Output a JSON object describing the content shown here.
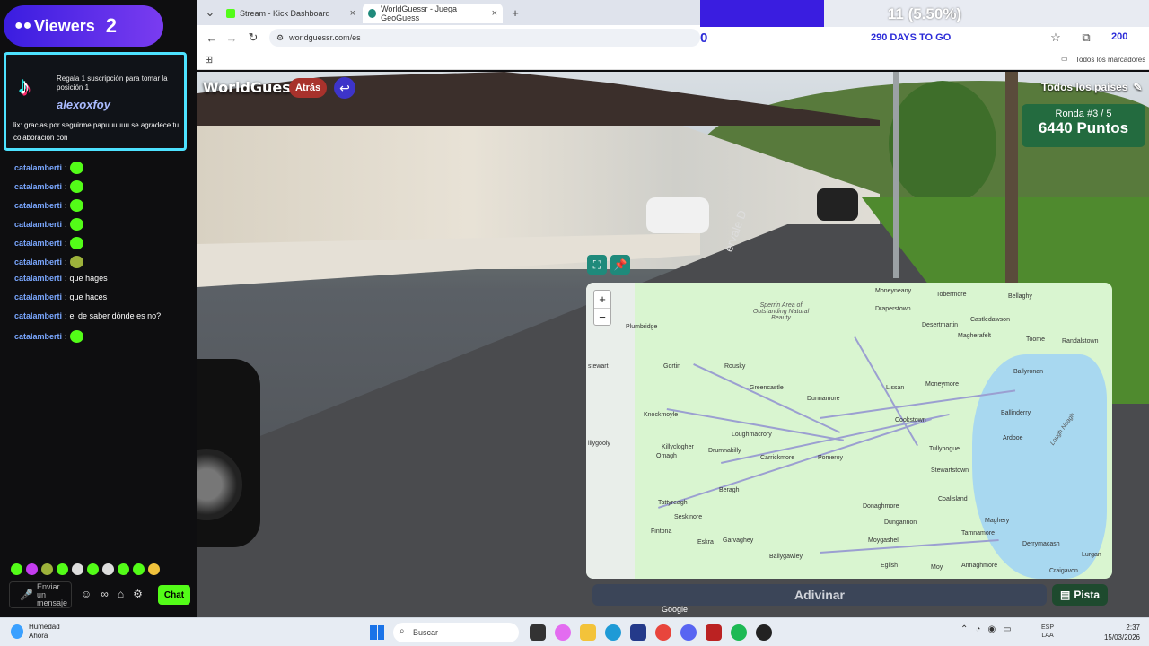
{
  "browser": {
    "tabs": [
      {
        "label": "Stream - Kick Dashboard",
        "icon": "kick-icon",
        "color": "#53fc18"
      },
      {
        "label": "WorldGuessr - Juega GeoGuess",
        "icon": "globe-icon",
        "color": "#1f8a7b"
      }
    ],
    "url": "worldguessr.com/es",
    "bookmarks_label": "Todos los marcadores",
    "profile_short": "200"
  },
  "overlay_progress": {
    "label": "11 (5.50%)",
    "fraction": 0.055,
    "start_value": "0",
    "days_left": "290 DAYS TO GO",
    "color": "#3a1de0"
  },
  "game": {
    "logo": "WorldGuessr",
    "back_label": "Atrás",
    "countries_label": "Todos los países",
    "round_label": "Ronda #3 / 5",
    "points_label": "6440 Puntos",
    "guess_label": "Adivinar",
    "hint_label": "Pista",
    "google_label": "Google",
    "zoom_in": "+",
    "zoom_out": "−",
    "street_sign": "ervale D",
    "places": [
      {
        "name": "Sperrin Area of Outstanding Natural Beauty",
        "italic": true
      },
      {
        "name": "Moneyneany"
      },
      {
        "name": "Tobermore"
      },
      {
        "name": "Bellaghy"
      },
      {
        "name": "Draperstown"
      },
      {
        "name": "Castledawson"
      },
      {
        "name": "Plumbridge"
      },
      {
        "name": "Desertmartin"
      },
      {
        "name": "Magherafelt"
      },
      {
        "name": "Toome"
      },
      {
        "name": "Randalstown"
      },
      {
        "name": "Gortin"
      },
      {
        "name": "Rousky"
      },
      {
        "name": "Ballyronan"
      },
      {
        "name": "Greencastle"
      },
      {
        "name": "Lissan"
      },
      {
        "name": "Moneymore"
      },
      {
        "name": "Dunnamore"
      },
      {
        "name": "Knockmoyle"
      },
      {
        "name": "Cookstown"
      },
      {
        "name": "Ballinderry"
      },
      {
        "name": "Loughmacrory"
      },
      {
        "name": "Tullyhogue"
      },
      {
        "name": "Ardboe"
      },
      {
        "name": "Killyclogher"
      },
      {
        "name": "Omagh"
      },
      {
        "name": "Drumnakilly"
      },
      {
        "name": "Carrickmore"
      },
      {
        "name": "Pomeroy"
      },
      {
        "name": "Stewartstown"
      },
      {
        "name": "Beragh"
      },
      {
        "name": "Coalisland"
      },
      {
        "name": "Tattyreagh"
      },
      {
        "name": "Seskinore"
      },
      {
        "name": "Donaghmore"
      },
      {
        "name": "Dungannon"
      },
      {
        "name": "Maghery"
      },
      {
        "name": "Fintona"
      },
      {
        "name": "Eskra"
      },
      {
        "name": "Garvaghey"
      },
      {
        "name": "Tamnamore"
      },
      {
        "name": "Derrymacash"
      },
      {
        "name": "Ballygawley"
      },
      {
        "name": "Moygashel"
      },
      {
        "name": "Eglish"
      },
      {
        "name": "Moy"
      },
      {
        "name": "Annaghmore"
      },
      {
        "name": "Craigavon"
      },
      {
        "name": "Lurgan"
      },
      {
        "name": "Lough Neagh",
        "italic": true
      },
      {
        "name": "stewart"
      },
      {
        "name": "illygooly"
      }
    ]
  },
  "stream_panel": {
    "viewers_label": "Viewers",
    "viewers_count": "2",
    "tiktok_gift": "Regala 1 suscripción para tomar la posición 1",
    "tiktok_user": "alexoxfoy",
    "tiktok_message": "lix: gracias por seguirme papuuuuuu se agradece tu colaboracion con",
    "chat": [
      {
        "user": "catalamberti",
        "text": "",
        "emote": true
      },
      {
        "user": "catalamberti",
        "text": "",
        "emote": true
      },
      {
        "user": "catalamberti",
        "text": "",
        "emote": true
      },
      {
        "user": "catalamberti",
        "text": "",
        "emote": true
      },
      {
        "user": "catalamberti",
        "text": "",
        "emote": true
      },
      {
        "user": "catalamberti",
        "text": "",
        "emote": true,
        "alt": true
      },
      {
        "user": "catalamberti",
        "text": "que hages",
        "emote": false
      },
      {
        "user": "catalamberti",
        "text": "que haces",
        "emote": false
      },
      {
        "user": "catalamberti",
        "text": "el de saber dónde es no?",
        "emote": false
      },
      {
        "user": "catalamberti",
        "text": "",
        "emote": true
      }
    ],
    "input_placeholder": "Enviar un mensaje",
    "chat_button": "Chat"
  },
  "taskbar": {
    "weather_title": "Humedad",
    "weather_sub": "Ahora",
    "search_placeholder": "Buscar",
    "lang_top": "ESP",
    "lang_bottom": "LAA",
    "time": "2:37",
    "date": "15/03/2026"
  }
}
